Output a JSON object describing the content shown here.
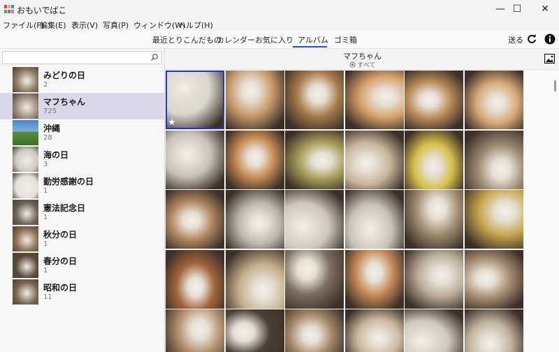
{
  "window": {
    "title": "おもいでばこ",
    "minimize_glyph": "—",
    "maximize_glyph": "☐",
    "close_glyph": "✕"
  },
  "menu": [
    "ファイル(F)",
    "編集(E)",
    "表示(V)",
    "写真(P)",
    "ウィンドウ(W)",
    "ヘルプ(H)"
  ],
  "tabs": [
    {
      "label": "最近とりこんだもの",
      "active": false
    },
    {
      "label": "カレンダー",
      "active": false
    },
    {
      "label": "お気に入り",
      "active": false
    },
    {
      "label": "アルバム",
      "active": true
    },
    {
      "label": "ゴミ箱",
      "active": false
    }
  ],
  "toolbar": {
    "send_label": "送る",
    "refresh_icon": "refresh-icon",
    "info_icon": "info-icon",
    "accent": "#1b4fd8"
  },
  "search": {
    "placeholder": "",
    "icon": "search-icon"
  },
  "albums": [
    {
      "name": "みどりの日",
      "count": "2",
      "selected": false
    },
    {
      "name": "マフちゃん",
      "count": "725",
      "selected": true
    },
    {
      "name": "沖縄",
      "count": "28",
      "selected": false
    },
    {
      "name": "海の日",
      "count": "3",
      "selected": false
    },
    {
      "name": "勤労感謝の日",
      "count": "1",
      "selected": false
    },
    {
      "name": "憲法記念日",
      "count": "1",
      "selected": false
    },
    {
      "name": "秋分の日",
      "count": "1",
      "selected": false
    },
    {
      "name": "春分の日",
      "count": "1",
      "selected": false
    },
    {
      "name": "昭和の日",
      "count": "11",
      "selected": false
    }
  ],
  "album_view": {
    "title": "マフちゃん",
    "filter_label": "すべて",
    "filter_icon": "filter-circle-icon",
    "image_icon": "image-icon",
    "selection_color": "#1f33e6"
  },
  "photo_colors": [
    [
      "#d9d7cf",
      "#c99d6c",
      "#a87b49",
      "#d8a26b",
      "#b98a57",
      "#d8a877"
    ],
    [
      "#c8c1b6",
      "#c88d55",
      "#a69c58",
      "#c7b49a",
      "#d6c14a",
      "#9c8a73"
    ],
    [
      "#b08760",
      "#b9b4aa",
      "#cfc6bd",
      "#c9c3b7",
      "#a28e72",
      "#c9a74e"
    ],
    [
      "#a3653a",
      "#c6b08e",
      "#7d6f60",
      "#c58a54",
      "#b9ab98",
      "#a88f75"
    ],
    [
      "#b28e6c",
      "#4b4038",
      "#a58a6a",
      "#c9b89f",
      "#d0c7bd",
      "#c2b3a0"
    ]
  ]
}
